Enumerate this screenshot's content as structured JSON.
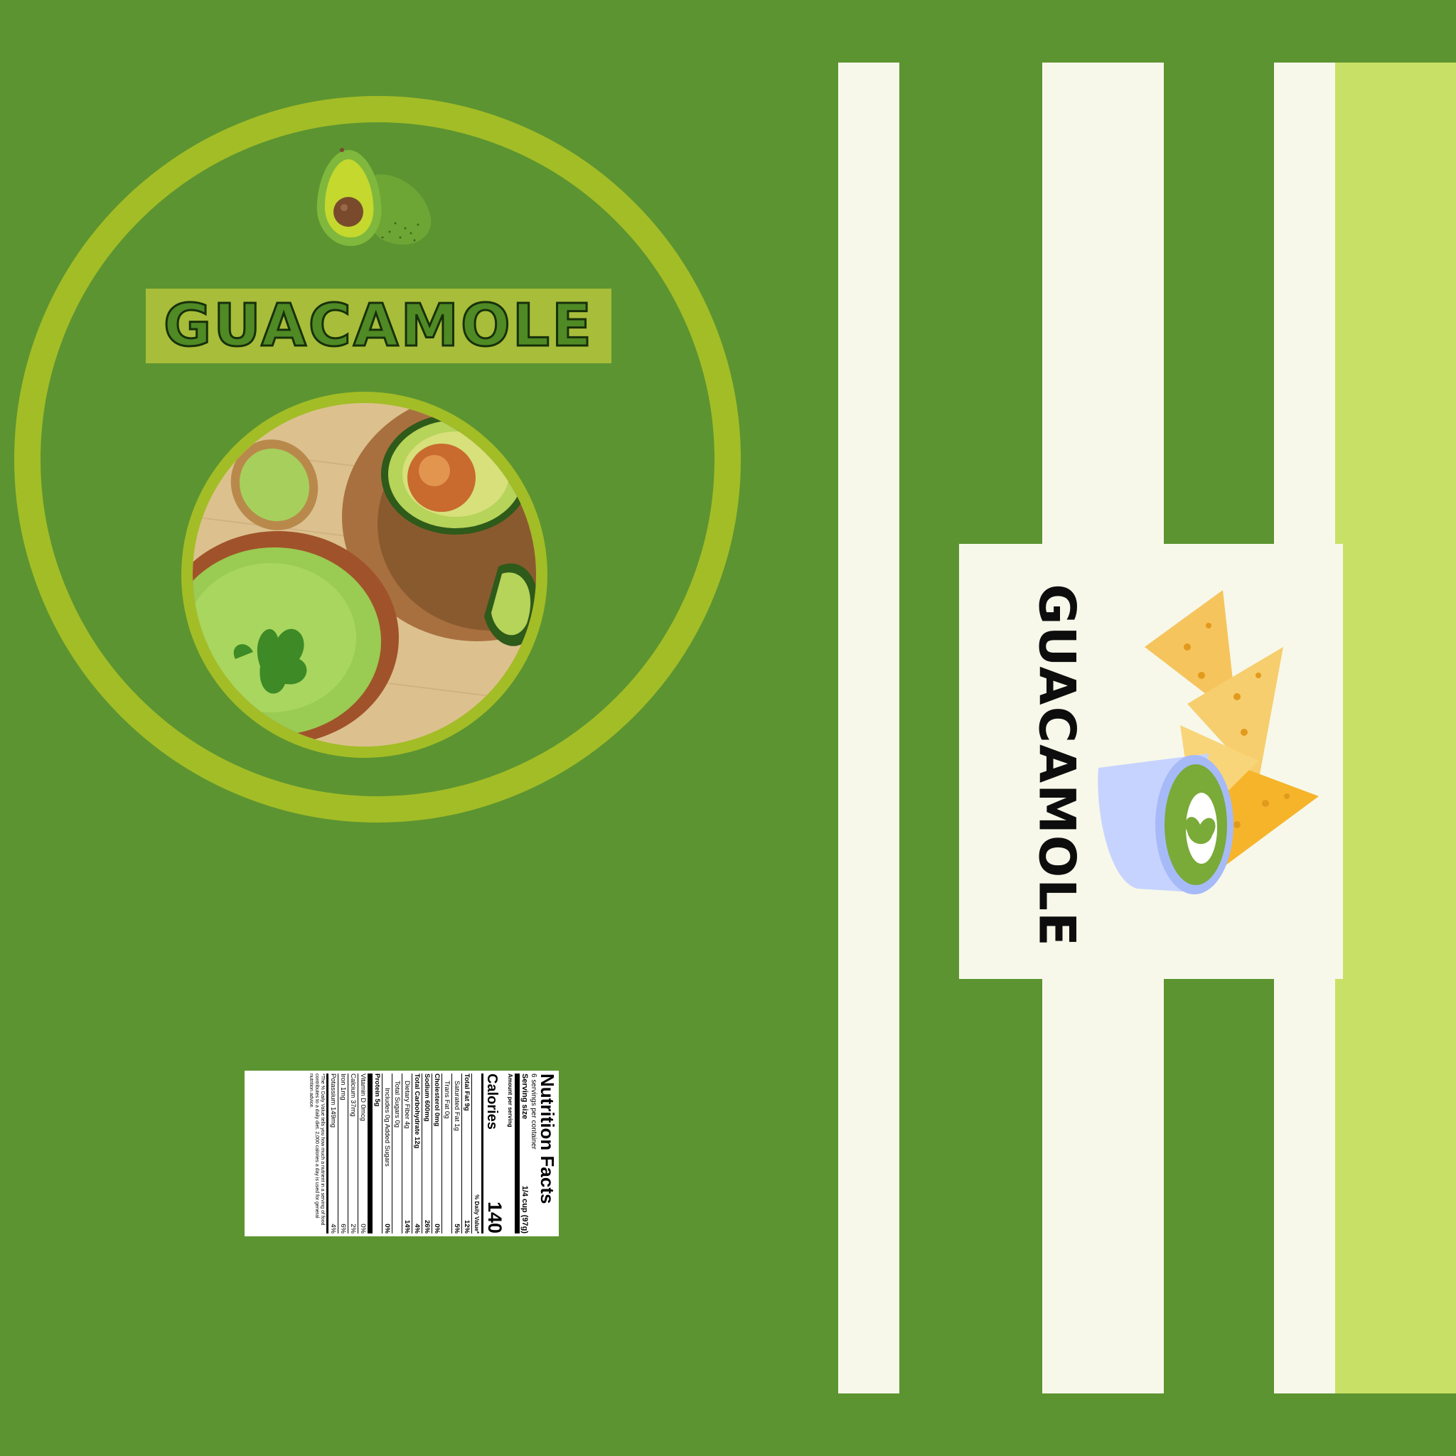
{
  "brand": {
    "title": "GUACAMOLE",
    "side_title": "GUACAMOLE"
  },
  "colors": {
    "background": "#5c9431",
    "ring": "#a3bd26",
    "title_box": "#a8bd3a",
    "stripe": "#f7f8ea",
    "lime_panel": "#c9e066"
  },
  "icons": {
    "avatar": "avocado-icon",
    "photo": "guacamole-bowl-photo",
    "side": "nachos-and-dip-icon"
  },
  "nutrition": {
    "title": "Nutrition Facts",
    "servings": "6 servings per container",
    "serving_size_label": "Serving size",
    "serving_size_value": "1/4 cup (97g)",
    "amount_per_serving": "Amount per serving",
    "calories_label": "Calories",
    "calories_value": "140",
    "dv_header": "% Daily Value*",
    "rows": [
      {
        "label": "Total Fat 9g",
        "dv": "12%"
      },
      {
        "label": "Saturated Fat 1g",
        "dv": "5%"
      },
      {
        "label": "Trans Fat 0g",
        "dv": ""
      },
      {
        "label": "Cholesterol 0mg",
        "dv": "0%"
      },
      {
        "label": "Sodium 600mg",
        "dv": "26%"
      },
      {
        "label": "Total Carbohydrate 12g",
        "dv": "4%"
      },
      {
        "label": "Dietary Fiber 4g",
        "dv": "14%"
      },
      {
        "label": "Total Sugars 0g",
        "dv": ""
      },
      {
        "label": "Includes 0g Added Sugars",
        "dv": "0%"
      },
      {
        "label": "Protein 5g",
        "dv": ""
      },
      {
        "label": "Vitamin D 0mcg",
        "dv": "0%"
      },
      {
        "label": "Calcium 37mg",
        "dv": "2%"
      },
      {
        "label": "Iron 1mg",
        "dv": "6%"
      },
      {
        "label": "Potassium 149mg",
        "dv": "4%"
      }
    ],
    "footnote": "*The % Daily Value tells you how much a nutrient in a serving of food contributes to a daily diet. 2,000 calories a day is used for general nutrition advice."
  }
}
